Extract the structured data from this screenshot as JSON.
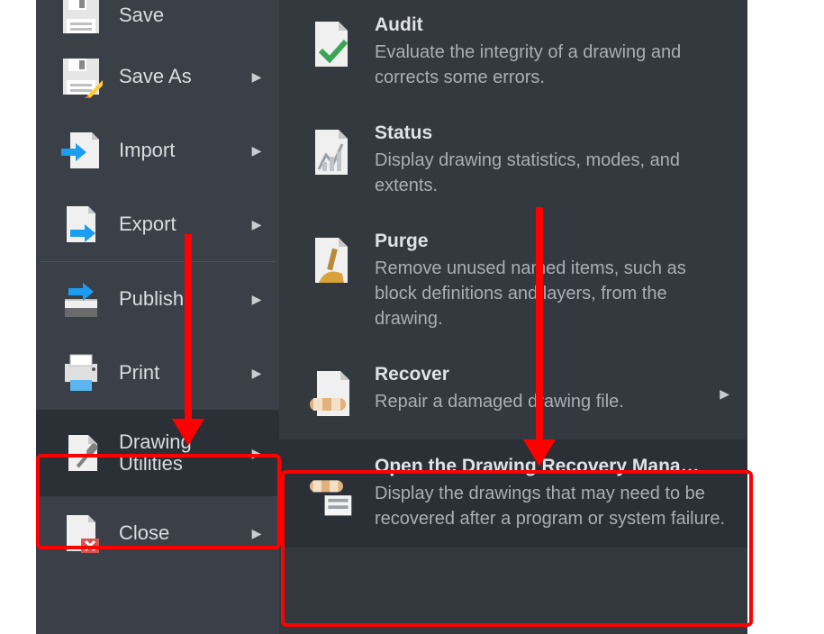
{
  "left": {
    "items": [
      {
        "label": "Save",
        "has_sub": false
      },
      {
        "label": "Save As",
        "has_sub": true
      },
      {
        "label": "Import",
        "has_sub": true
      },
      {
        "label": "Export",
        "has_sub": true
      },
      {
        "label": "Publish",
        "has_sub": true
      },
      {
        "label": "Print",
        "has_sub": true
      },
      {
        "label": "Drawing\nUtilities",
        "has_sub": true
      },
      {
        "label": "Close",
        "has_sub": true
      }
    ]
  },
  "right": {
    "items": [
      {
        "title": "Audit",
        "desc": "Evaluate the integrity of a drawing and corrects some errors.",
        "has_sub": false
      },
      {
        "title": "Status",
        "desc": "Display drawing statistics, modes, and extents.",
        "has_sub": false
      },
      {
        "title": "Purge",
        "desc": "Remove unused named items, such as block definitions and layers, from the drawing.",
        "has_sub": false
      },
      {
        "title": "Recover",
        "desc": "Repair a damaged drawing file.",
        "has_sub": true
      },
      {
        "title": "Open the Drawing Recovery Mana…",
        "desc": "Display the drawings that may need to be recovered after a program or system failure.",
        "has_sub": false
      }
    ]
  }
}
